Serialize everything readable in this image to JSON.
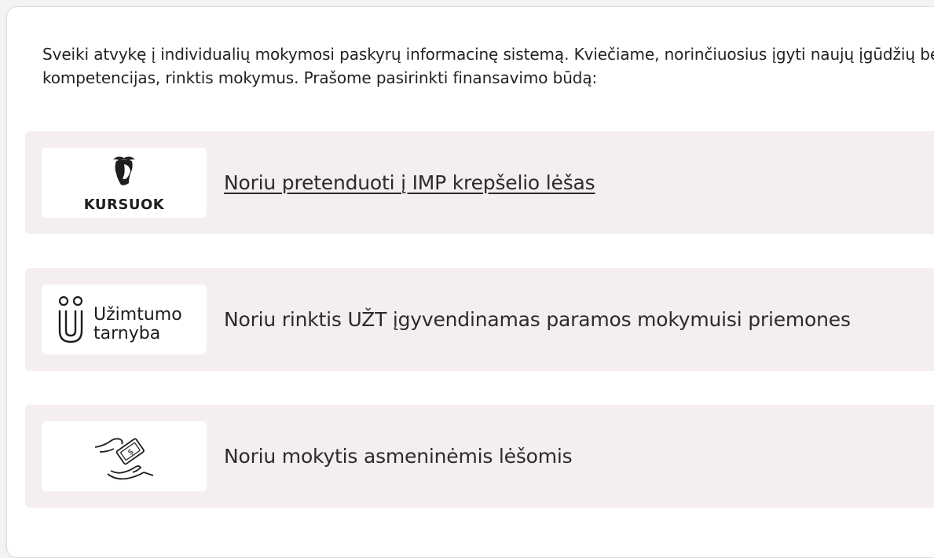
{
  "intro": {
    "line1": "Sveiki atvykę į individualių mokymosi paskyrų informacinę sistemą. Kviečiame, norinčiuosius įgyti naujų įgūdžių bei tob",
    "line2": "kompetencijas, rinktis mokymus. Prašome pasirinkti finansavimo būdą:"
  },
  "options": [
    {
      "label": "Noriu pretenduoti į IMP krepšelio lėšas",
      "logo_text": "KURSUOK",
      "logo_icon": "kursuok-mascot-icon",
      "underlined": true
    },
    {
      "label": "Noriu rinktis UŽT įgyvendinamas paramos mokymuisi priemones",
      "logo_text_line1": "Užimtumo",
      "logo_text_line2": "tarnyba",
      "logo_icon": "uzt-magnet-icon"
    },
    {
      "label": "Noriu mokytis asmeninėmis lėšomis",
      "logo_icon": "money-hands-icon"
    }
  ],
  "colors": {
    "option_background": "#f5eef0",
    "panel_background": "#ffffff",
    "text": "#222222"
  }
}
